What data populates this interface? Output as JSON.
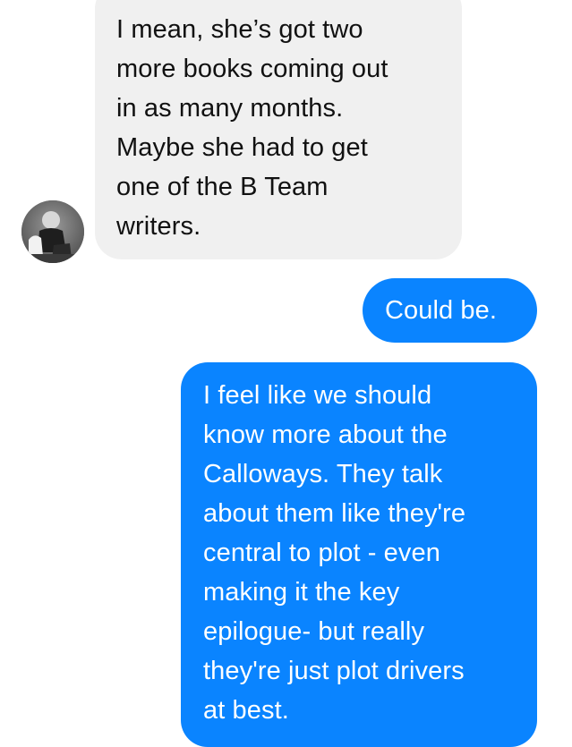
{
  "conversation": {
    "messages": [
      {
        "direction": "incoming",
        "text": "I mean, she’s got two\nmore books coming out\nin as many months.\nMaybe she had to get\none of the B Team\nwriters."
      },
      {
        "direction": "outgoing",
        "text": "Could be."
      },
      {
        "direction": "outgoing",
        "text": "I feel like we should\nknow more about the\nCalloways. They talk\nabout them like they're\ncentral to plot - even\nmaking it the key\nepilogue- but really\nthey're just plot drivers\nat best."
      }
    ],
    "sender_avatar_icon": "contact-avatar-photo"
  },
  "colors": {
    "incoming_bubble": "#f0f0f0",
    "incoming_text": "#111111",
    "outgoing_bubble": "#0a84ff",
    "outgoing_text": "#ffffff",
    "background": "#ffffff"
  }
}
